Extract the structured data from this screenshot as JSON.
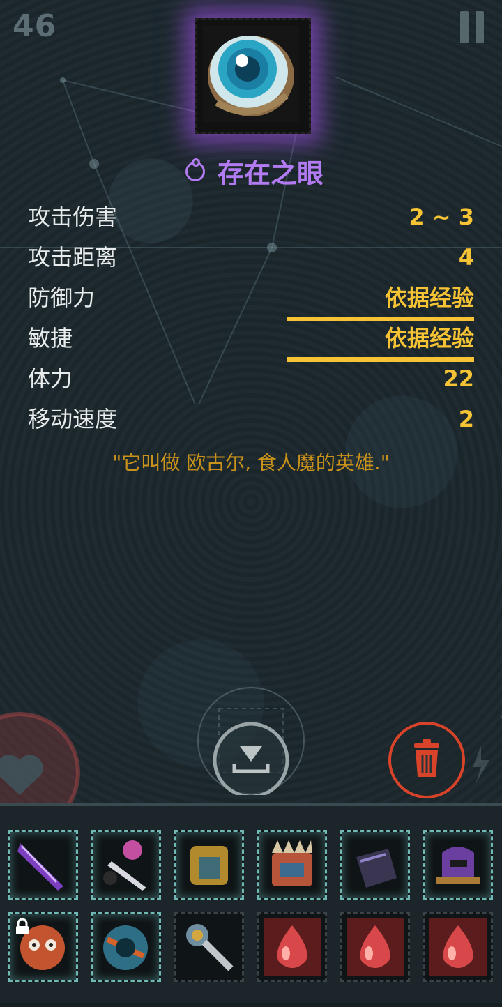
{
  "hud": {
    "turn_counter": "46"
  },
  "item": {
    "name": "存在之眼",
    "type_icon": "ring-icon",
    "stats": [
      {
        "label": "攻击伤害",
        "value": "2 ~ 3",
        "underlined": false
      },
      {
        "label": "攻击距离",
        "value": "4",
        "underlined": false
      },
      {
        "label": "防御力",
        "value": "依据经验",
        "underlined": true
      },
      {
        "label": "敏捷",
        "value": "依据经验",
        "underlined": true
      },
      {
        "label": "体力",
        "value": "22",
        "underlined": false
      },
      {
        "label": "移动速度",
        "value": "2",
        "underlined": false
      }
    ],
    "flavor": "\"它叫做 欧古尔, 食人魔的英雄.\""
  },
  "actions": {
    "drop_icon": "drop-icon",
    "trash_icon": "trash-icon"
  },
  "inventory": {
    "row1": [
      "purple-blade-icon",
      "pink-dagger-icon",
      "golden-armor-icon",
      "spiked-armor-icon",
      "dark-gauntlet-icon",
      "purple-helmet-icon"
    ],
    "row2": [
      "orange-mask-icon",
      "blue-orb-icon",
      "key-wand-icon",
      "red-potion-icon",
      "red-potion-icon",
      "red-potion-icon"
    ],
    "locked_slot": "orange-mask-icon"
  },
  "colors": {
    "accent_purple": "#b27bf2",
    "stat_yellow": "#f5c334",
    "flavor_gold": "#c9921a",
    "trash_red": "#d8432a"
  }
}
